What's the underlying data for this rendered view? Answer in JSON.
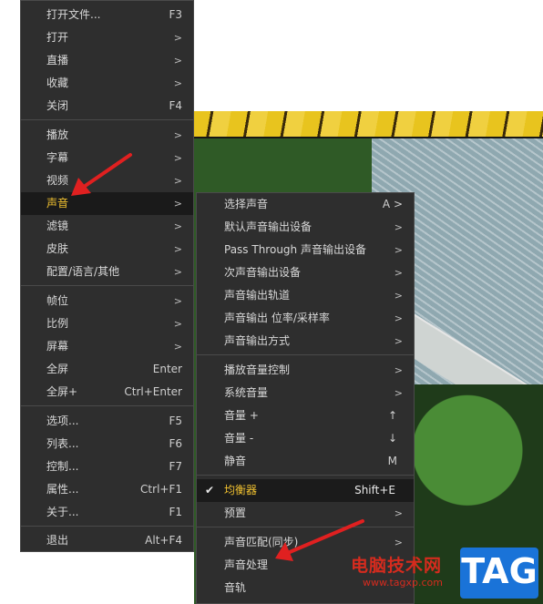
{
  "main_menu": {
    "items": [
      {
        "label": "打开文件...",
        "key": "F3"
      },
      {
        "label": "打开",
        "arrow": ">"
      },
      {
        "label": "直播",
        "arrow": ">"
      },
      {
        "label": "收藏",
        "arrow": ">"
      },
      {
        "label": "关闭",
        "key": "F4"
      },
      {
        "label": "播放",
        "arrow": ">"
      },
      {
        "label": "字幕",
        "arrow": ">"
      },
      {
        "label": "视频",
        "arrow": ">"
      },
      {
        "label": "声音",
        "arrow": ">"
      },
      {
        "label": "滤镜",
        "arrow": ">"
      },
      {
        "label": "皮肤",
        "arrow": ">"
      },
      {
        "label": "配置/语言/其他",
        "arrow": ">"
      },
      {
        "label": "帧位",
        "arrow": ">"
      },
      {
        "label": "比例",
        "arrow": ">"
      },
      {
        "label": "屏幕",
        "arrow": ">"
      },
      {
        "label": "全屏",
        "key": "Enter"
      },
      {
        "label": "全屏+",
        "key": "Ctrl+Enter"
      },
      {
        "label": "选项...",
        "key": "F5"
      },
      {
        "label": "列表...",
        "key": "F6"
      },
      {
        "label": "控制...",
        "key": "F7"
      },
      {
        "label": "属性...",
        "key": "Ctrl+F1"
      },
      {
        "label": "关于...",
        "key": "F1"
      },
      {
        "label": "退出",
        "key": "Alt+F4"
      }
    ]
  },
  "sound_submenu": {
    "items": [
      {
        "label": "选择声音",
        "key": "A >"
      },
      {
        "label": "默认声音输出设备",
        "arrow": ">"
      },
      {
        "label": "Pass Through 声音输出设备",
        "arrow": ">"
      },
      {
        "label": "次声音输出设备",
        "arrow": ">"
      },
      {
        "label": "声音输出轨道",
        "arrow": ">"
      },
      {
        "label": "声音输出 位率/采样率",
        "arrow": ">"
      },
      {
        "label": "声音输出方式",
        "arrow": ">"
      },
      {
        "label": "播放音量控制",
        "arrow": ">"
      },
      {
        "label": "系统音量",
        "arrow": ">"
      },
      {
        "label": "音量 +",
        "key": "↑"
      },
      {
        "label": "音量 -",
        "key": "↓"
      },
      {
        "label": "静音",
        "key": "M"
      },
      {
        "label": "均衡器",
        "key": "Shift+E",
        "check": "✔"
      },
      {
        "label": "预置",
        "arrow": ">"
      },
      {
        "label": "声音匹配(同步)",
        "arrow": ">"
      },
      {
        "label": "声音处理",
        "arrow": ""
      },
      {
        "label": "音轨",
        "arrow": ""
      }
    ]
  },
  "watermark": {
    "site_name": "电脑技术网",
    "url": "www.tagxp.com",
    "logo_text": "TAG"
  },
  "colors": {
    "menu_bg": "#2e2e2e",
    "highlight_text": "#f2c230",
    "annotation_arrow": "#e02020",
    "watermark_red": "#d52b1e",
    "logo_blue": "#1a73d8"
  }
}
